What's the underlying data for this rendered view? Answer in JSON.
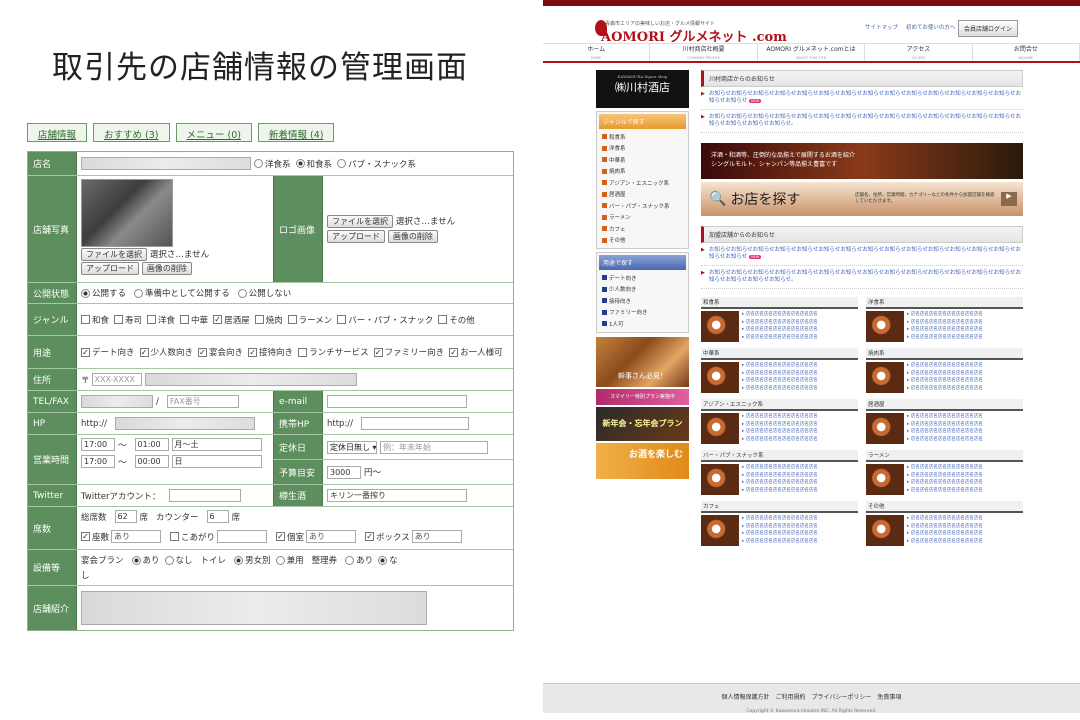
{
  "headline": "取引先の店舗情報の管理画面",
  "tabs": [
    "店舗情報",
    "おすすめ (3)",
    "メニュー (0)",
    "新着情報 (4)"
  ],
  "form": {
    "shop_name": {
      "label": "店名",
      "types": [
        "洋食系",
        "和食系",
        "パブ・スナック系"
      ],
      "selected": 1
    },
    "photo": {
      "label": "店舗写真",
      "file_btn": "ファイルを選択",
      "file_status": "選択さ…ません",
      "upload": "アップロード",
      "delete": "画像の削除"
    },
    "logo": {
      "label": "ロゴ画像",
      "file_btn": "ファイルを選択",
      "file_status": "選択さ…ません",
      "upload": "アップロード",
      "delete": "画像の削除"
    },
    "status": {
      "label": "公開状態",
      "options": [
        "公開する",
        "準備中として公開する",
        "公開しない"
      ],
      "selected": 0
    },
    "genre": {
      "label": "ジャンル",
      "items": [
        {
          "name": "和食",
          "on": false
        },
        {
          "name": "寿司",
          "on": false
        },
        {
          "name": "洋食",
          "on": false
        },
        {
          "name": "中華",
          "on": false
        },
        {
          "name": "居酒屋",
          "on": true
        },
        {
          "name": "焼肉",
          "on": false
        },
        {
          "name": "ラーメン",
          "on": false
        },
        {
          "name": "バー・パブ・スナック",
          "on": false
        },
        {
          "name": "その他",
          "on": false
        }
      ]
    },
    "purpose": {
      "label": "用途",
      "items": [
        {
          "name": "デート向き",
          "on": true
        },
        {
          "name": "少人数向き",
          "on": true
        },
        {
          "name": "宴会向き",
          "on": true
        },
        {
          "name": "接待向き",
          "on": true
        },
        {
          "name": "ランチサービス",
          "on": false
        },
        {
          "name": "ファミリー向き",
          "on": true
        },
        {
          "name": "お一人様可",
          "on": true
        }
      ]
    },
    "address": {
      "label": "住所",
      "zip_prefix": "〒",
      "zip_placeholder": "XXX-XXXX"
    },
    "tel": {
      "label": "TEL/FAX",
      "sep": "/",
      "fax_placeholder": "FAX番号",
      "email_label": "e-mail"
    },
    "hp": {
      "label": "HP",
      "prefix": "http://",
      "mobile_label": "携帯HP",
      "mobile_prefix": "http://"
    },
    "hours": {
      "label": "営業時間",
      "open1": "17:00",
      "close1": "01:00",
      "days1": "月〜土",
      "open2": "17:00",
      "close2": "00:00",
      "days2": "日",
      "tilde": "〜",
      "holiday_label": "定休日",
      "holiday_select": "定休日無し",
      "holiday_placeholder": "例：年末年始",
      "budget_label": "予算目安",
      "budget_value": "3000",
      "budget_unit": "円〜"
    },
    "twitter": {
      "label": "Twitter",
      "text": "Twitterアカウント：",
      "beer_label": "樽生酒",
      "beer_value": "キリン一番搾り"
    },
    "seats": {
      "label": "席数",
      "total_label": "総席数",
      "total": "62",
      "unit": "席",
      "counter_label": "カウンター",
      "counter": "6",
      "types": [
        {
          "name": "座敷",
          "on": true,
          "val": "あり"
        },
        {
          "name": "こあがり",
          "on": false,
          "val": ""
        },
        {
          "name": "個室",
          "on": true,
          "val": "あり"
        },
        {
          "name": "ボックス",
          "on": true,
          "val": "あり"
        }
      ]
    },
    "facility": {
      "label": "設備等",
      "party_plan": "宴会プラン",
      "party_opts": [
        "あり",
        "なし"
      ],
      "party_sel": 0,
      "toilet": "トイレ",
      "toilet_opts": [
        "男女別",
        "兼用"
      ],
      "toilet_sel": 0,
      "parking": "整理券",
      "parking_opts": [
        "あり",
        "な"
      ],
      "parking_sel": 1,
      "parking_wrap": "し"
    },
    "intro": {
      "label": "店舗紹介"
    }
  },
  "site": {
    "logo_sub": "青森市エリアの美味しいお店・グルメ情報サイト",
    "logo": "AOMORI グルメネット .com",
    "links": [
      "サイトマップ",
      "初めてお使いの方へ"
    ],
    "login": "会員店舗ログイン",
    "nav": [
      {
        "label": "ホーム",
        "sub": "HOME"
      },
      {
        "label": "川村商店社概要",
        "sub": "COMPANY PROFILE"
      },
      {
        "label": "AOMORI グルメネット.comとは",
        "sub": "ABOUT THIS SITE"
      },
      {
        "label": "アクセス",
        "sub": "ACCESS"
      },
      {
        "label": "お問合せ",
        "sub": "INQUIRE"
      }
    ],
    "shop_banner": "㈱川村酒店",
    "shop_banner_sub": "KAWAMURA liquor shop",
    "side_genre_h": "ジャンルで探す",
    "side_genre": [
      "和食系",
      "洋食系",
      "中華系",
      "焼肉系",
      "アジアン・エスニック系",
      "居酒屋",
      "バー・パブ・スナック系",
      "ラーメン",
      "カフェ",
      "その他"
    ],
    "side_purpose_h": "用途で探す",
    "side_purpose": [
      "デート向き",
      "少人数向き",
      "接待向き",
      "ファミリー向き",
      "1人可"
    ],
    "side_pic1": "幹事さん必見！",
    "side_pic2": "スマイリー特別プラン実施中",
    "side_pic3": "新年会・忘年会プラン",
    "side_pic4": "お酒を楽しむ",
    "main_h1": "川村商店からのお知らせ",
    "news1": [
      "お知らせお知らせお知らせお知らせお知らせお知らせお知らせお知らせお知らせお知らせお知らせお知らせお知らせお知らせお知らせお知らせ",
      "お知らせお知らせお知らせお知らせお知らせお知らせお知らせお知らせお知らせお知らせお知らせお知らせお知らせお知らせお知らせお知らせお知らせお知らせ。"
    ],
    "new_badge": "NEW",
    "bn1": "洋酒・和酒等、圧倒的な品揃えで展開するお酒を紹介\nシングルモルト、シャンパン等品揃え豊富です",
    "bn2": "お店を探す",
    "bn2_sub": "店舗名、住所、営業時間、カテゴリーなどの条件から加盟店舗を検索していただけます。",
    "main_h2": "加盟店舗からのお知らせ",
    "news2": [
      "お知らせお知らせお知らせお知らせお知らせお知らせお知らせお知らせお知らせお知らせお知らせお知らせお知らせお知らせお知らせお知らせ",
      "お知らせお知らせお知らせお知らせお知らせお知らせお知らせお知らせお知らせお知らせお知らせお知らせお知らせお知らせお知らせお知らせお知らせお知らせ。"
    ],
    "cats": [
      "和食系",
      "洋食系",
      "中華系",
      "焼肉系",
      "アジアン・エスニック系",
      "居酒屋",
      "バー・パブ・スナック系",
      "ラーメン",
      "カフェ",
      "その他"
    ],
    "cat_link": "店名店名店名店名店名店名店名店名",
    "footer_links": "個人情報保護方針　ご利用規約　プライバシーポリシー　免責事項",
    "copyright": "Copyright © Kawamura-shouten INC. All Rights Reserved."
  }
}
